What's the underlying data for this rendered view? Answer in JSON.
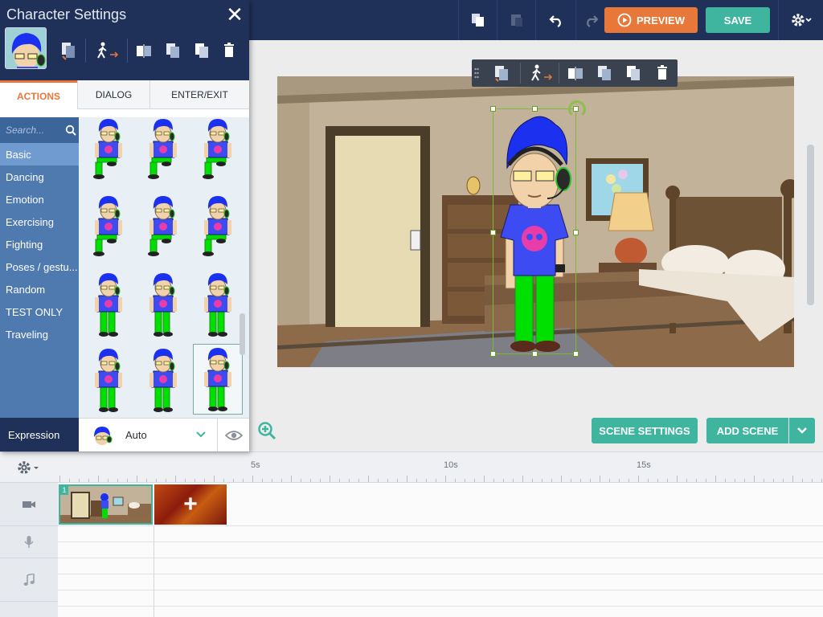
{
  "toolbar": {
    "preview_label": "PREVIEW",
    "save_label": "SAVE",
    "icons": [
      "copy-icon",
      "paste-icon",
      "undo-icon",
      "redo-icon",
      "settings-gear-icon"
    ]
  },
  "character_panel": {
    "title": "Character Settings",
    "close_label": "✕",
    "tabs": [
      {
        "label": "ACTIONS",
        "active": true
      },
      {
        "label": "DIALOG",
        "active": false
      },
      {
        "label": "ENTER/EXIT",
        "active": false
      }
    ],
    "search": {
      "placeholder": "Search..."
    },
    "categories": [
      {
        "label": "Basic",
        "active": true
      },
      {
        "label": "Dancing"
      },
      {
        "label": "Emotion"
      },
      {
        "label": "Exercising"
      },
      {
        "label": "Fighting"
      },
      {
        "label": "Poses / gestu..."
      },
      {
        "label": "Random"
      },
      {
        "label": "TEST ONLY"
      },
      {
        "label": "Traveling"
      }
    ],
    "expression": {
      "label": "Expression",
      "value": "Auto"
    }
  },
  "stage": {
    "scene_settings_label": "SCENE SETTINGS",
    "add_scene_label": "ADD SCENE"
  },
  "timeline": {
    "ticks": [
      "5s",
      "10s",
      "15s"
    ],
    "scene_number": "1",
    "add_scene_symbol": "+"
  },
  "colors": {
    "navy": "#1f3158",
    "teal": "#3fb5a0",
    "orange": "#e8783a",
    "category_blue": "#4f7ab0"
  }
}
